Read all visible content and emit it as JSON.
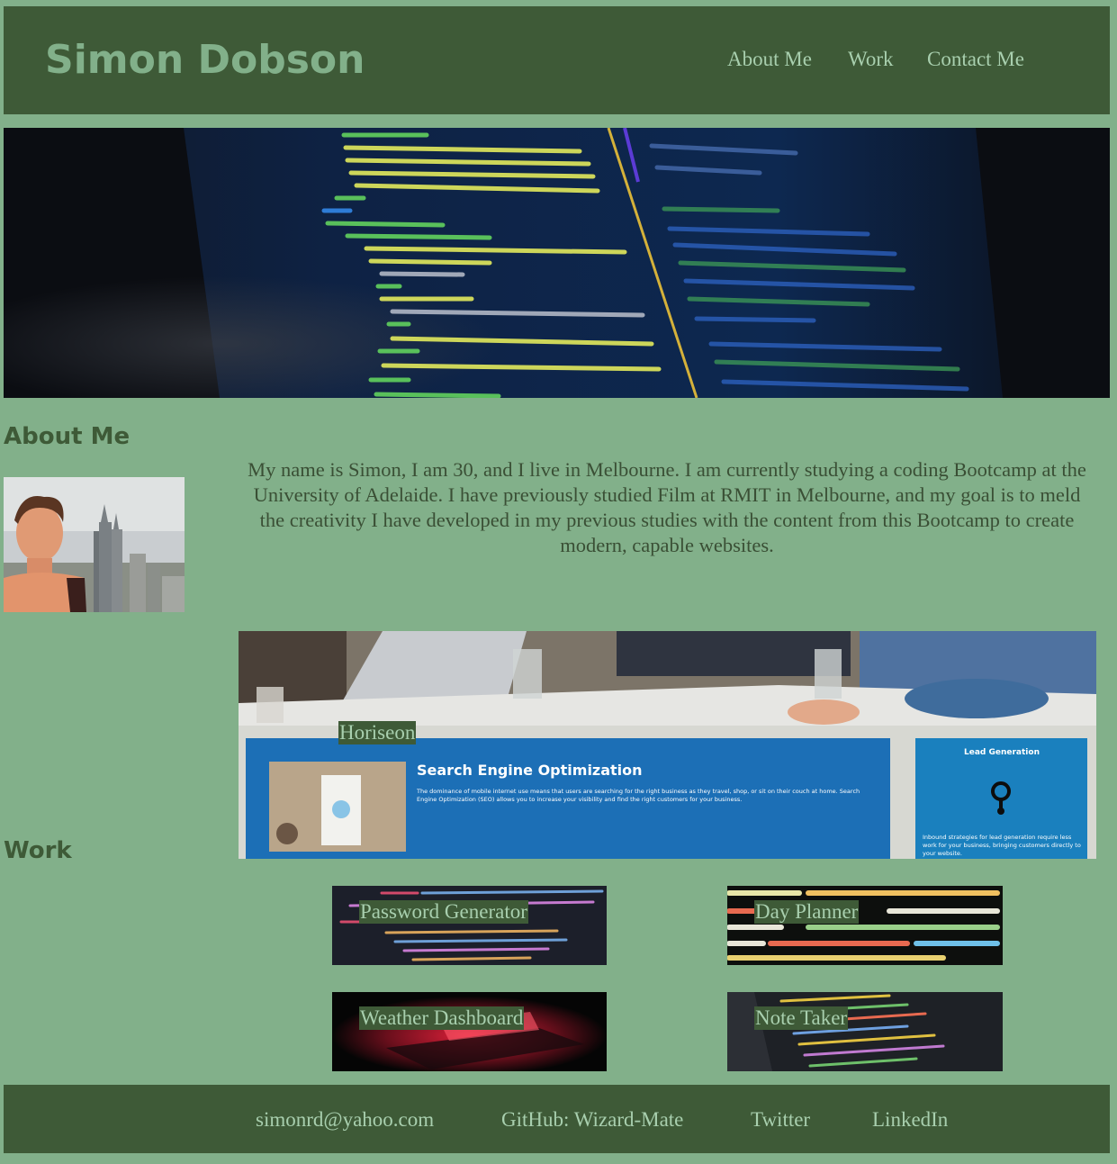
{
  "header": {
    "title": "Simon Dobson",
    "nav": [
      "About Me",
      "Work",
      "Contact Me"
    ]
  },
  "about": {
    "heading": "About Me",
    "text": "My name is Simon, I am 30, and I live in Melbourne. I am currently studying a coding Bootcamp at the University of Adelaide. I have previously studied Film at RMIT in Melbourne, and my goal is to meld the creativity I have developed in my previous studies with the content from this Bootcamp to create modern, capable websites."
  },
  "work": {
    "heading": "Work",
    "featured": {
      "label": "Horiseon",
      "seo_title": "Search Engine Optimization",
      "seo_text": "The dominance of mobile internet use means that users are searching for the right business as they travel, shop, or sit on their couch at home. Search Engine Optimization (SEO) allows you to increase your visibility and find the right customers for your business.",
      "lead_title": "Lead Generation",
      "lead_text": "Inbound strategies for lead generation require less work for your business, bringing customers directly to your website."
    },
    "projects": [
      "Password Generator",
      "Day Planner",
      "Weather Dashboard",
      "Note Taker"
    ]
  },
  "footer": {
    "links": [
      "simonrd@yahoo.com",
      "GitHub: Wizard-Mate",
      "Twitter",
      "LinkedIn"
    ]
  },
  "colors": {
    "page_bg": "#82b08a",
    "header_bg": "#3e5a37",
    "accent_text": "#a8cfae"
  }
}
